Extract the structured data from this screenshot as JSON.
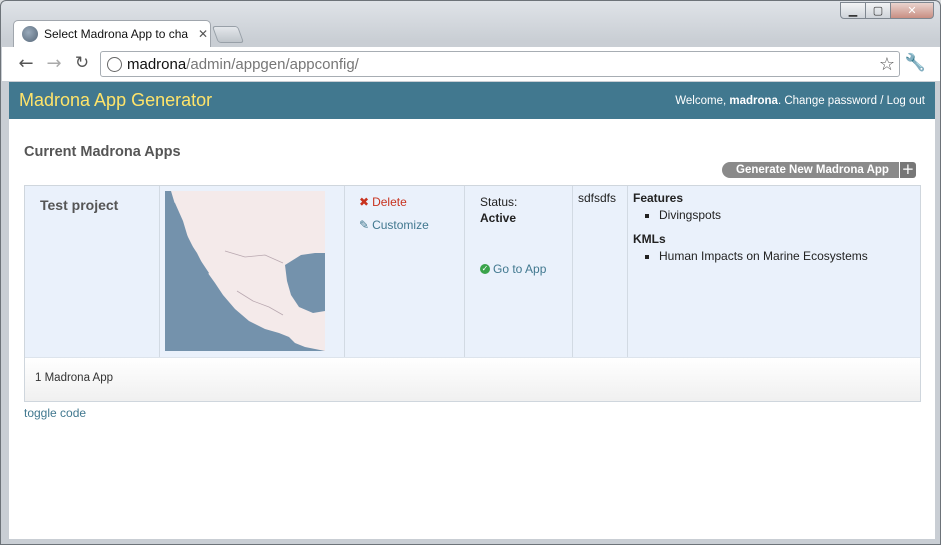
{
  "browser": {
    "tab_title": "Select Madrona App to cha",
    "url_host": "madrona",
    "url_path": "/admin/appgen/appconfig/",
    "controls": {
      "minimize": "▁",
      "maximize": "▢",
      "close": "✕"
    }
  },
  "header": {
    "title": "Madrona App Generator",
    "welcome_prefix": "Welcome, ",
    "username": "madrona",
    "welcome_suffix": ". ",
    "change_password": "Change password",
    "separator": " / ",
    "logout": "Log out",
    "bg_color": "#41788f",
    "title_color": "#ffe46a"
  },
  "main": {
    "section_title": "Current Madrona Apps",
    "generate_button": "Generate New Madrona App",
    "generate_plus": "+",
    "apps": [
      {
        "name": "Test project",
        "delete_label": "Delete",
        "customize_label": "Customize",
        "status_label": "Status:",
        "status_value": "Active",
        "goto_label": "Go to App",
        "code": "sdfsdfs",
        "features_label": "Features",
        "features": [
          "Divingspots"
        ],
        "kmls_label": "KMLs",
        "kmls": [
          "Human Impacts on Marine Ecosystems"
        ]
      }
    ],
    "footer_count": "1 Madrona App",
    "toggle_code": "toggle code"
  }
}
